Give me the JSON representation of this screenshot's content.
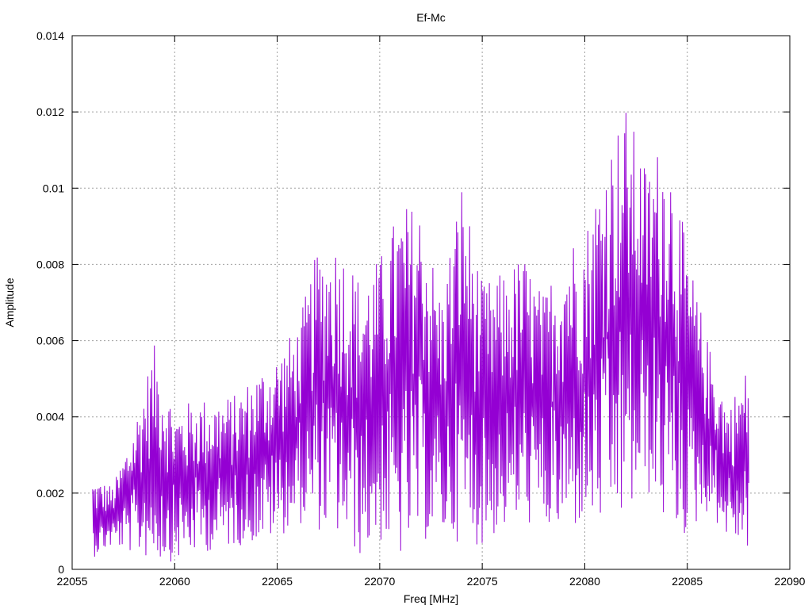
{
  "chart_data": {
    "type": "line",
    "title": "Ef-Mc",
    "xlabel": "Freq [MHz]",
    "ylabel": "Amplitude",
    "xlim": [
      22055,
      22090
    ],
    "ylim": [
      0,
      0.014
    ],
    "xticks": [
      22055,
      22060,
      22065,
      22070,
      22075,
      22080,
      22085,
      22090
    ],
    "xtick_labels": [
      "22055",
      "22060",
      "22065",
      "22070",
      "22075",
      "22080",
      "22085",
      "22090"
    ],
    "yticks": [
      0,
      0.002,
      0.004,
      0.006,
      0.008,
      0.01,
      0.012,
      0.014
    ],
    "ytick_labels": [
      "0",
      "0.002",
      "0.004",
      "0.006",
      "0.008",
      "0.01",
      "0.012",
      "0.014"
    ],
    "grid": true,
    "legend": "none",
    "series": [
      {
        "color": "#9400d3",
        "x_range": [
          22056,
          22088
        ],
        "envelope_x": [
          22056,
          22057,
          22058,
          22059,
          22060,
          22061,
          22062,
          22063,
          22064,
          22065,
          22066,
          22067,
          22068,
          22069,
          22070,
          22071,
          22072,
          22073,
          22074,
          22075,
          22076,
          22077,
          22078,
          22079,
          22080,
          22081,
          22082,
          22083,
          22084,
          22085,
          22086,
          22087,
          22088
        ],
        "envelope_max": [
          0.0024,
          0.0022,
          0.0038,
          0.0059,
          0.0042,
          0.0045,
          0.0045,
          0.0046,
          0.0052,
          0.0057,
          0.0064,
          0.0085,
          0.0087,
          0.0077,
          0.0082,
          0.0096,
          0.0096,
          0.0072,
          0.0103,
          0.0075,
          0.0078,
          0.0083,
          0.0072,
          0.0087,
          0.0089,
          0.011,
          0.0122,
          0.0106,
          0.0115,
          0.0084,
          0.006,
          0.0043,
          0.0054
        ],
        "envelope_min": [
          0.0003,
          0.0006,
          0.0004,
          0.0002,
          0.0002,
          0.0004,
          0.0005,
          0.0006,
          0.0007,
          0.0008,
          0.0012,
          0.001,
          0.0008,
          0.0003,
          0.0007,
          0.0002,
          0.0007,
          0.0008,
          0.0007,
          0.0006,
          0.001,
          0.0012,
          0.001,
          0.0008,
          0.0012,
          0.001,
          0.0012,
          0.002,
          0.001,
          0.0008,
          0.0015,
          0.0008,
          0.0005
        ],
        "points_approx": 1000
      }
    ]
  }
}
